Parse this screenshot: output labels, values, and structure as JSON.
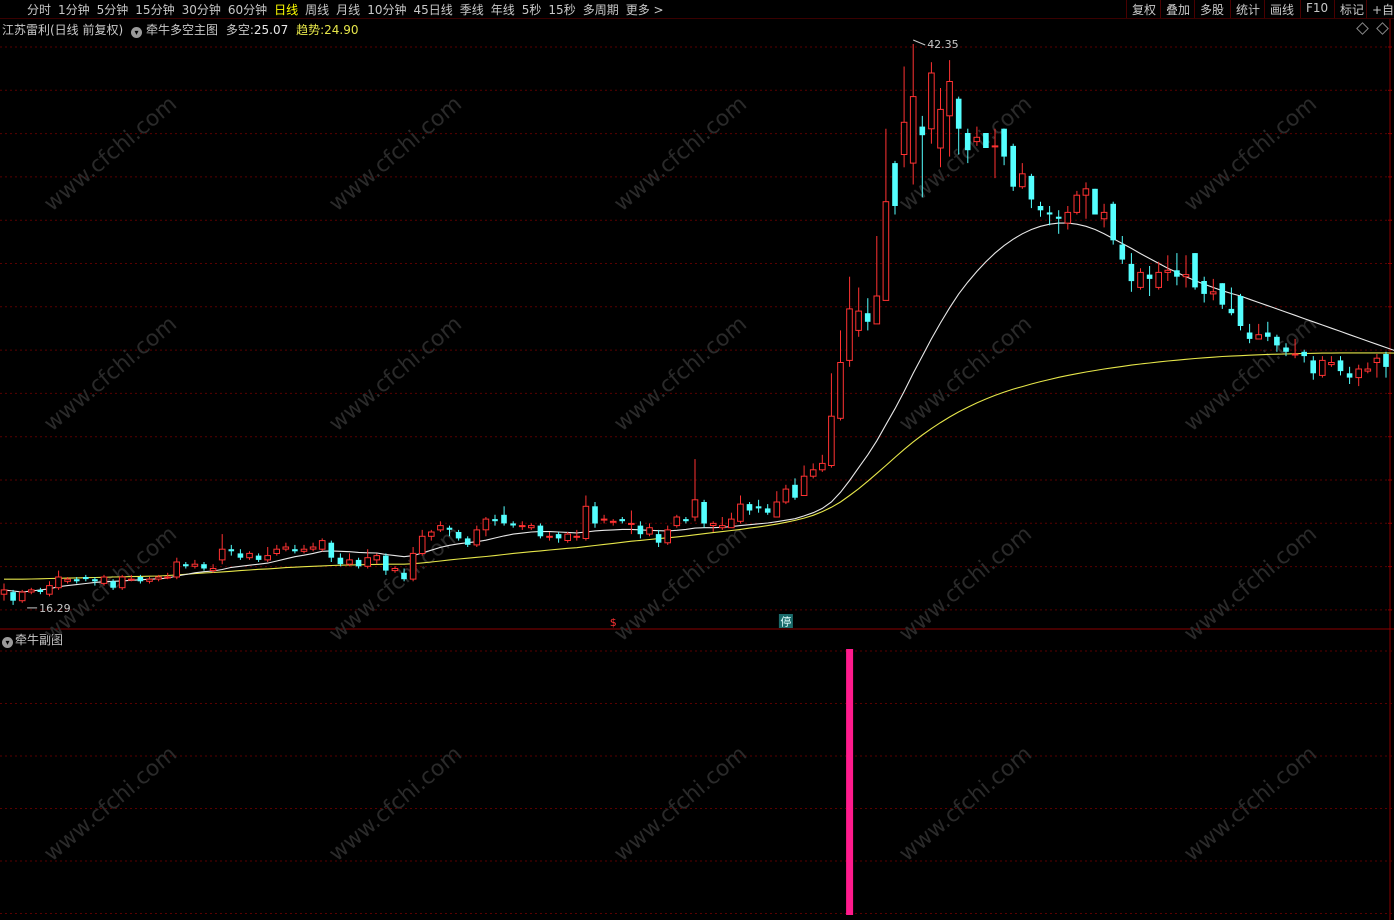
{
  "toolbar": {
    "periods": [
      "分时",
      "1分钟",
      "5分钟",
      "15分钟",
      "30分钟",
      "60分钟",
      "日线",
      "周线",
      "月线",
      "10分钟",
      "45日线",
      "季线",
      "年线",
      "5秒",
      "15秒",
      "多周期",
      "更多 >"
    ],
    "active_period": "日线",
    "right_buttons": [
      "复权",
      "叠加",
      "多股",
      "统计",
      "画线",
      "F10",
      "标记",
      "+自"
    ]
  },
  "main_chart": {
    "stock_name": "江苏雷利(日线 前复权)",
    "indicator_name": "牵牛多空主图",
    "duokong_label": "多空:",
    "duokong_value": "25.07",
    "trend_label": "趋势:",
    "trend_value": "24.90",
    "high_label": "42.35",
    "low_label": "16.29",
    "marker_s": "$",
    "marker_ting": "停"
  },
  "sub_chart": {
    "title": "牵牛副图"
  },
  "colors": {
    "up": "#ff3232",
    "down": "#54ffff",
    "white_line": "#e8e8e8",
    "yellow_line": "#e6e64a",
    "grid": "#5a0000",
    "signal_bar": "#ff1a8c",
    "active_period": "#ffff00"
  },
  "chart_data": {
    "type": "candlestick",
    "price_range": [
      16.0,
      44.0
    ],
    "high": 42.35,
    "low": 16.29,
    "candles": [
      [
        16.7,
        16.9,
        17.2,
        16.4
      ],
      [
        16.8,
        16.4,
        16.9,
        16.2
      ],
      [
        16.4,
        16.8,
        16.9,
        16.3
      ],
      [
        16.8,
        16.9,
        17.0,
        16.7
      ],
      [
        16.9,
        16.8,
        17.0,
        16.7
      ],
      [
        16.7,
        17.1,
        17.3,
        16.6
      ],
      [
        17.0,
        17.5,
        17.8,
        16.9
      ],
      [
        17.3,
        17.4,
        17.5,
        17.2
      ],
      [
        17.4,
        17.3,
        17.5,
        17.2
      ],
      [
        17.5,
        17.4,
        17.6,
        17.3
      ],
      [
        17.4,
        17.3,
        17.5,
        17.1
      ],
      [
        17.2,
        17.5,
        17.6,
        17.1
      ],
      [
        17.3,
        17.0,
        17.4,
        16.9
      ],
      [
        17.0,
        17.5,
        17.6,
        16.9
      ],
      [
        17.4,
        17.4,
        17.6,
        17.3
      ],
      [
        17.5,
        17.3,
        17.6,
        17.2
      ],
      [
        17.3,
        17.4,
        17.5,
        17.2
      ],
      [
        17.4,
        17.5,
        17.6,
        17.3
      ],
      [
        17.5,
        17.5,
        17.7,
        17.4
      ],
      [
        17.5,
        18.2,
        18.4,
        17.4
      ],
      [
        18.1,
        18.0,
        18.2,
        17.9
      ],
      [
        18.0,
        18.1,
        18.3,
        17.9
      ],
      [
        18.1,
        17.9,
        18.2,
        17.8
      ],
      [
        17.8,
        17.9,
        18.1,
        17.7
      ],
      [
        18.3,
        18.8,
        19.5,
        18.1
      ],
      [
        18.8,
        18.7,
        19.0,
        18.5
      ],
      [
        18.6,
        18.4,
        18.8,
        18.3
      ],
      [
        18.4,
        18.6,
        18.7,
        18.3
      ],
      [
        18.5,
        18.3,
        18.6,
        18.2
      ],
      [
        18.3,
        18.5,
        18.9,
        18.2
      ],
      [
        18.6,
        18.8,
        19.0,
        18.5
      ],
      [
        18.8,
        18.9,
        19.1,
        18.7
      ],
      [
        18.8,
        18.7,
        19.0,
        18.6
      ],
      [
        18.7,
        18.8,
        19.0,
        18.6
      ],
      [
        18.8,
        18.9,
        19.1,
        18.7
      ],
      [
        18.8,
        19.2,
        19.3,
        18.7
      ],
      [
        19.1,
        18.4,
        19.2,
        18.2
      ],
      [
        18.4,
        18.1,
        18.6,
        18.0
      ],
      [
        18.1,
        18.3,
        18.6,
        18.0
      ],
      [
        18.3,
        18.0,
        18.4,
        17.9
      ],
      [
        18.0,
        18.4,
        18.8,
        17.9
      ],
      [
        18.3,
        18.5,
        18.6,
        18.1
      ],
      [
        18.5,
        17.8,
        18.6,
        17.6
      ],
      [
        17.8,
        17.9,
        18.0,
        17.7
      ],
      [
        17.7,
        17.4,
        17.9,
        17.3
      ],
      [
        17.4,
        18.6,
        18.9,
        17.3
      ],
      [
        18.6,
        19.4,
        19.7,
        18.5
      ],
      [
        19.4,
        19.6,
        19.7,
        19.2
      ],
      [
        19.7,
        19.9,
        20.1,
        19.6
      ],
      [
        19.8,
        19.7,
        19.9,
        19.4
      ],
      [
        19.6,
        19.3,
        19.7,
        19.2
      ],
      [
        19.3,
        19.0,
        19.4,
        18.9
      ],
      [
        19.0,
        19.7,
        19.9,
        18.9
      ],
      [
        19.7,
        20.2,
        20.3,
        19.4
      ],
      [
        20.2,
        20.1,
        20.4,
        19.9
      ],
      [
        20.4,
        20.0,
        20.8,
        19.9
      ],
      [
        20.0,
        19.9,
        20.1,
        19.8
      ],
      [
        19.9,
        19.9,
        20.1,
        19.7
      ],
      [
        19.8,
        19.9,
        20.0,
        19.7
      ],
      [
        19.9,
        19.4,
        20.0,
        19.3
      ],
      [
        19.4,
        19.4,
        19.6,
        19.2
      ],
      [
        19.5,
        19.3,
        19.6,
        19.1
      ],
      [
        19.2,
        19.5,
        19.6,
        19.1
      ],
      [
        19.4,
        19.4,
        19.7,
        19.2
      ],
      [
        19.3,
        20.8,
        21.3,
        19.2
      ],
      [
        20.8,
        20.0,
        21.0,
        19.8
      ],
      [
        20.2,
        20.2,
        20.4,
        20.0
      ],
      [
        20.1,
        20.1,
        20.2,
        19.9
      ],
      [
        20.2,
        20.1,
        20.3,
        20.0
      ],
      [
        20.0,
        20.0,
        20.6,
        19.5
      ],
      [
        19.9,
        19.5,
        20.1,
        19.3
      ],
      [
        19.5,
        19.8,
        20.0,
        19.4
      ],
      [
        19.5,
        19.1,
        19.7,
        18.9
      ],
      [
        19.1,
        19.7,
        19.9,
        19.0
      ],
      [
        19.9,
        20.3,
        20.4,
        19.8
      ],
      [
        20.2,
        20.1,
        20.3,
        20.0
      ],
      [
        20.3,
        21.1,
        23.0,
        20.1
      ],
      [
        21.0,
        20.0,
        21.1,
        19.8
      ],
      [
        19.9,
        20.0,
        20.1,
        19.6
      ],
      [
        19.8,
        19.9,
        20.3,
        19.7
      ],
      [
        19.8,
        20.2,
        20.5,
        19.8
      ],
      [
        20.1,
        20.9,
        21.3,
        20.0
      ],
      [
        20.9,
        20.6,
        21.0,
        20.4
      ],
      [
        20.8,
        20.7,
        21.1,
        20.5
      ],
      [
        20.7,
        20.5,
        20.9,
        20.4
      ],
      [
        20.3,
        21.0,
        21.5,
        20.3
      ],
      [
        21.0,
        21.6,
        21.8,
        20.9
      ],
      [
        21.8,
        21.2,
        22.1,
        21.1
      ],
      [
        21.3,
        22.2,
        22.7,
        21.3
      ],
      [
        22.2,
        22.5,
        22.8,
        22.1
      ],
      [
        22.5,
        22.8,
        23.2,
        22.4
      ],
      [
        22.7,
        25.0,
        27.0,
        22.6
      ],
      [
        24.9,
        27.5,
        29.0,
        24.8
      ],
      [
        27.6,
        30.0,
        31.5,
        27.3
      ],
      [
        29.0,
        29.9,
        31.0,
        28.7
      ],
      [
        29.8,
        29.4,
        30.5,
        29.0
      ],
      [
        29.3,
        30.6,
        33.4,
        29.3
      ],
      [
        30.4,
        35.0,
        38.4,
        30.4
      ],
      [
        36.8,
        34.8,
        36.9,
        34.4
      ],
      [
        37.2,
        38.7,
        41.3,
        36.6
      ],
      [
        36.8,
        39.9,
        42.35,
        35.8
      ],
      [
        38.5,
        38.1,
        39.0,
        35.2
      ],
      [
        38.4,
        41.0,
        41.5,
        37.7
      ],
      [
        37.5,
        39.3,
        40.3,
        36.6
      ],
      [
        39.0,
        40.6,
        41.6,
        37.1
      ],
      [
        39.8,
        38.4,
        39.9,
        37.2
      ],
      [
        38.2,
        37.4,
        38.4,
        36.8
      ],
      [
        37.8,
        38.0,
        38.5,
        37.6
      ],
      [
        38.2,
        37.5,
        38.2,
        37.5
      ],
      [
        37.6,
        37.6,
        38.4,
        36.1
      ],
      [
        38.4,
        37.1,
        38.4,
        36.7
      ],
      [
        37.6,
        35.7,
        37.7,
        35.5
      ],
      [
        35.7,
        36.3,
        36.8,
        35.6
      ],
      [
        36.2,
        35.1,
        36.3,
        34.7
      ],
      [
        34.8,
        34.6,
        35.0,
        34.3
      ],
      [
        34.5,
        34.4,
        34.8,
        33.9
      ],
      [
        34.3,
        34.2,
        34.6,
        33.5
      ],
      [
        34.0,
        34.5,
        34.8,
        33.7
      ],
      [
        34.5,
        35.3,
        35.5,
        34.4
      ],
      [
        35.3,
        35.6,
        35.9,
        34.2
      ],
      [
        35.6,
        34.4,
        35.6,
        34.4
      ],
      [
        34.2,
        34.5,
        34.9,
        33.8
      ],
      [
        34.9,
        33.2,
        35.0,
        33.0
      ],
      [
        33.0,
        32.3,
        33.4,
        32.1
      ],
      [
        32.1,
        31.3,
        32.6,
        30.8
      ],
      [
        31.0,
        31.7,
        31.9,
        30.9
      ],
      [
        31.6,
        31.4,
        32.0,
        30.6
      ],
      [
        31.0,
        31.7,
        32.2,
        30.9
      ],
      [
        31.7,
        31.8,
        32.5,
        31.3
      ],
      [
        31.8,
        31.5,
        32.6,
        31.1
      ],
      [
        31.5,
        31.6,
        32.5,
        31.0
      ],
      [
        32.6,
        31.0,
        32.6,
        30.9
      ],
      [
        31.3,
        30.7,
        31.5,
        30.3
      ],
      [
        30.7,
        30.8,
        31.4,
        30.4
      ],
      [
        31.2,
        30.2,
        31.2,
        30.0
      ],
      [
        30.0,
        29.8,
        31.0,
        29.7
      ],
      [
        30.6,
        29.2,
        30.7,
        29.0
      ],
      [
        28.9,
        28.6,
        29.3,
        28.4
      ],
      [
        28.6,
        28.8,
        29.3,
        28.6
      ],
      [
        28.9,
        28.7,
        29.4,
        28.5
      ],
      [
        28.7,
        28.3,
        28.8,
        28.0
      ],
      [
        28.2,
        28.0,
        28.4,
        27.8
      ],
      [
        27.9,
        27.9,
        28.6,
        27.7
      ],
      [
        28.0,
        27.8,
        28.1,
        27.5
      ],
      [
        27.6,
        27.0,
        27.8,
        26.7
      ],
      [
        26.9,
        27.6,
        27.8,
        26.8
      ],
      [
        27.4,
        27.5,
        27.8,
        27.3
      ],
      [
        27.6,
        27.1,
        27.8,
        26.9
      ],
      [
        27.0,
        26.8,
        27.3,
        26.5
      ],
      [
        26.8,
        27.2,
        27.4,
        26.4
      ],
      [
        27.1,
        27.2,
        27.5,
        27.0
      ],
      [
        27.5,
        27.7,
        27.9,
        26.8
      ],
      [
        27.9,
        27.3,
        28.0,
        26.8
      ]
    ],
    "ma_white": [
      16.9,
      16.85,
      16.8,
      16.85,
      16.9,
      16.95,
      17.05,
      17.1,
      17.15,
      17.2,
      17.25,
      17.28,
      17.3,
      17.32,
      17.35,
      17.37,
      17.4,
      17.42,
      17.45,
      17.55,
      17.62,
      17.7,
      17.75,
      17.78,
      17.85,
      17.95,
      18.0,
      18.05,
      18.1,
      18.15,
      18.25,
      18.35,
      18.45,
      18.52,
      18.6,
      18.7,
      18.72,
      18.7,
      18.68,
      18.65,
      18.63,
      18.62,
      18.55,
      18.5,
      18.45,
      18.5,
      18.62,
      18.75,
      18.88,
      18.98,
      19.05,
      19.1,
      19.15,
      19.22,
      19.32,
      19.42,
      19.5,
      19.55,
      19.6,
      19.62,
      19.62,
      19.6,
      19.58,
      19.56,
      19.6,
      19.65,
      19.68,
      19.7,
      19.72,
      19.72,
      19.7,
      19.68,
      19.66,
      19.65,
      19.68,
      19.72,
      19.78,
      19.8,
      19.8,
      19.82,
      19.85,
      19.9,
      19.94,
      19.98,
      20.02,
      20.08,
      20.15,
      20.22,
      20.35,
      20.5,
      20.7,
      21.0,
      21.45,
      22.0,
      22.6,
      23.2,
      23.85,
      24.6,
      25.35,
      26.15,
      27.0,
      27.8,
      28.6,
      29.35,
      30.05,
      30.7,
      31.25,
      31.75,
      32.2,
      32.6,
      32.95,
      33.25,
      33.5,
      33.7,
      33.85,
      33.95,
      34.0,
      34.0,
      33.95,
      33.85,
      33.7,
      33.5,
      33.28,
      33.05,
      32.82,
      32.58,
      32.35,
      32.12,
      31.9,
      31.7,
      31.5,
      31.32,
      31.15,
      31.0,
      30.85,
      30.72,
      30.6,
      30.45,
      30.3,
      30.15,
      30.0,
      29.85,
      29.7,
      29.55,
      29.4,
      29.25,
      29.1,
      28.95,
      28.8,
      28.65,
      28.5,
      28.35,
      28.2,
      28.05,
      27.93,
      27.8,
      27.7
    ],
    "ma_yellow": [
      17.4,
      17.4,
      17.4,
      17.41,
      17.42,
      17.43,
      17.44,
      17.45,
      17.46,
      17.47,
      17.48,
      17.49,
      17.5,
      17.51,
      17.52,
      17.53,
      17.54,
      17.55,
      17.57,
      17.6,
      17.63,
      17.66,
      17.69,
      17.71,
      17.74,
      17.77,
      17.8,
      17.83,
      17.86,
      17.88,
      17.91,
      17.94,
      17.96,
      17.98,
      18.0,
      18.02,
      18.04,
      18.05,
      18.06,
      18.07,
      18.08,
      18.09,
      18.1,
      18.1,
      18.1,
      18.12,
      18.16,
      18.2,
      18.25,
      18.3,
      18.34,
      18.38,
      18.42,
      18.46,
      18.5,
      18.55,
      18.6,
      18.64,
      18.68,
      18.72,
      18.76,
      18.8,
      18.84,
      18.87,
      18.92,
      18.97,
      19.02,
      19.07,
      19.12,
      19.17,
      19.21,
      19.25,
      19.29,
      19.33,
      19.37,
      19.42,
      19.47,
      19.52,
      19.57,
      19.62,
      19.67,
      19.72,
      19.78,
      19.84,
      19.9,
      19.97,
      20.05,
      20.14,
      20.25,
      20.38,
      20.55,
      20.75,
      21.0,
      21.3,
      21.62,
      21.97,
      22.33,
      22.7,
      23.08,
      23.45,
      23.8,
      24.12,
      24.42,
      24.7,
      24.96,
      25.2,
      25.42,
      25.62,
      25.8,
      25.97,
      26.12,
      26.26,
      26.38,
      26.5,
      26.61,
      26.71,
      26.81,
      26.9,
      26.98,
      27.06,
      27.13,
      27.2,
      27.26,
      27.32,
      27.38,
      27.43,
      27.48,
      27.53,
      27.57,
      27.61,
      27.65,
      27.69,
      27.72,
      27.75,
      27.78,
      27.8,
      27.82,
      27.84,
      27.86,
      27.88,
      27.89,
      27.9,
      27.91,
      27.92,
      27.93,
      27.94,
      27.94,
      27.95,
      27.95,
      27.95,
      27.95,
      27.95,
      27.95,
      27.94,
      27.94,
      27.93,
      27.93
    ],
    "signal_bar_index": 93,
    "marker_s_index": 67,
    "marker_ting_index": 86
  }
}
